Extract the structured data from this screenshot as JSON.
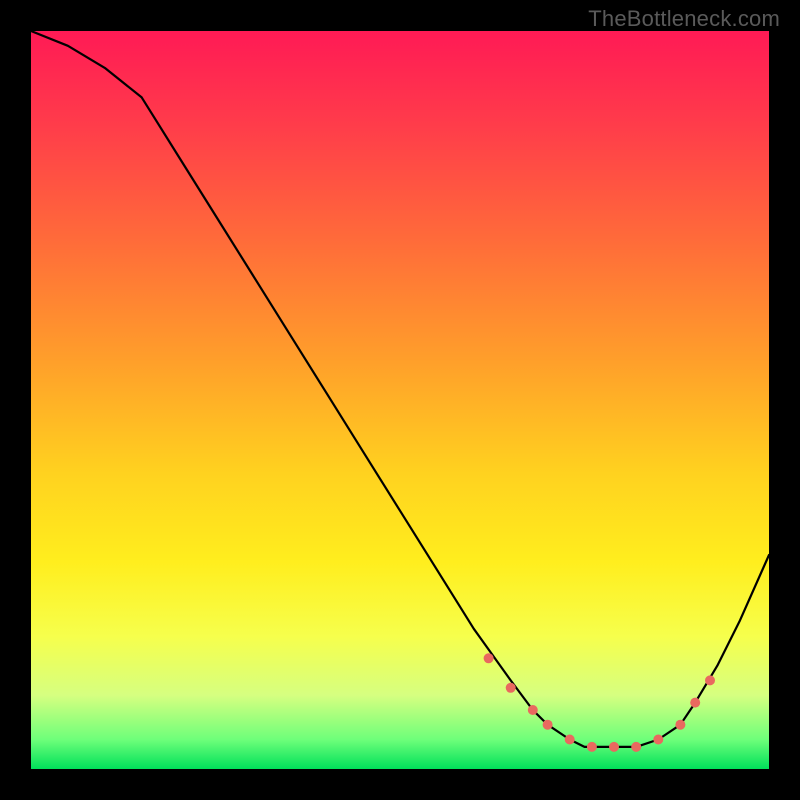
{
  "watermark": "TheBottleneck.com",
  "chart_data": {
    "type": "line",
    "title": "",
    "xlabel": "",
    "ylabel": "",
    "xlim": [
      0,
      100
    ],
    "ylim": [
      0,
      100
    ],
    "series": [
      {
        "name": "bottleneck-curve",
        "x": [
          0,
          5,
          10,
          15,
          20,
          25,
          30,
          35,
          40,
          45,
          50,
          55,
          60,
          65,
          68,
          70,
          73,
          75,
          78,
          80,
          82,
          85,
          88,
          90,
          93,
          96,
          100
        ],
        "values": [
          100,
          98,
          95,
          91,
          83,
          75,
          67,
          59,
          51,
          43,
          35,
          27,
          19,
          12,
          8,
          6,
          4,
          3,
          3,
          3,
          3,
          4,
          6,
          9,
          14,
          20,
          29
        ]
      }
    ],
    "markers": {
      "name": "highlight-dots",
      "color": "#e9695f",
      "x": [
        62,
        65,
        68,
        70,
        73,
        76,
        79,
        82,
        85,
        88,
        90,
        92
      ],
      "values": [
        15,
        11,
        8,
        6,
        4,
        3,
        3,
        3,
        4,
        6,
        9,
        12
      ]
    }
  }
}
